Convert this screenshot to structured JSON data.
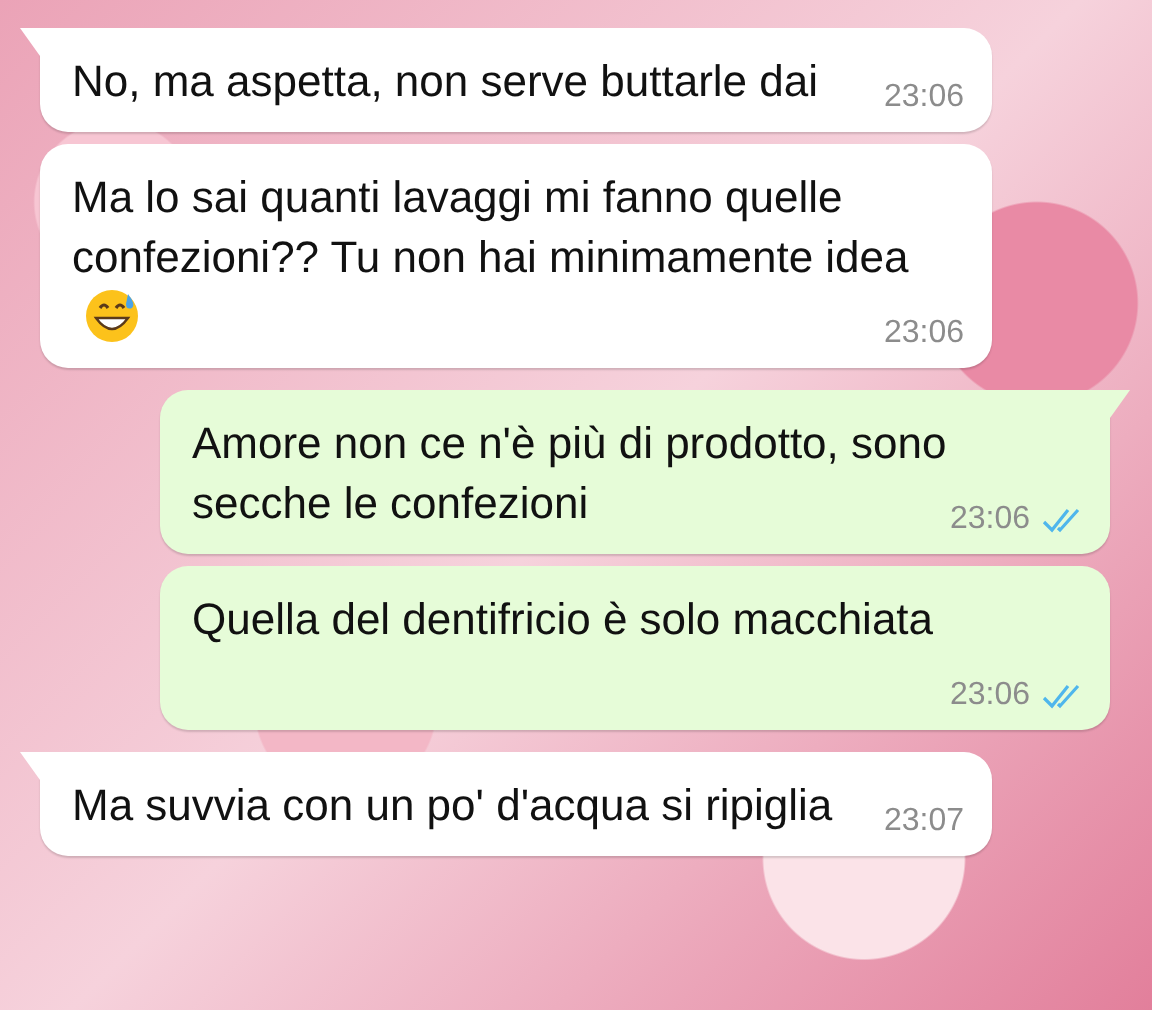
{
  "messages": [
    {
      "kind": "received",
      "first_in_group": true,
      "text": "No, ma aspetta, non serve buttarle dai",
      "emoji": false,
      "time": "23:06"
    },
    {
      "kind": "received",
      "first_in_group": false,
      "text": "Ma lo sai quanti lavaggi mi fanno quelle confezioni?? Tu non hai minimamente idea",
      "emoji": true,
      "time": "23:06"
    },
    {
      "kind": "sent",
      "first_in_group": true,
      "text": "Amore non ce n'è più di prodotto, sono secche le confezioni",
      "emoji": false,
      "time": "23:06",
      "read": true
    },
    {
      "kind": "sent",
      "first_in_group": false,
      "text": "Quella del dentifricio è solo macchiata",
      "emoji": false,
      "time": "23:06",
      "read": true
    },
    {
      "kind": "received",
      "first_in_group": true,
      "text": "Ma suvvia con un po' d'acqua si ripiglia",
      "emoji": false,
      "time": "23:07"
    }
  ]
}
